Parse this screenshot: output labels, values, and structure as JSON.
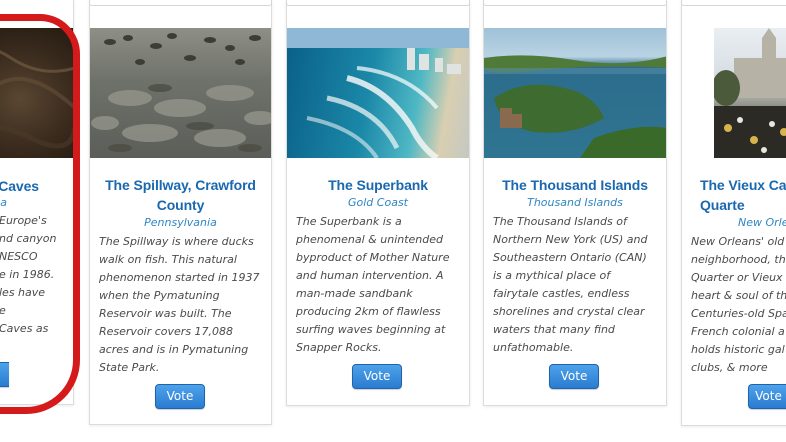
{
  "cards": [
    {
      "title": "Caves",
      "subtitle": "a",
      "description": "Europe's\nnd canyon\nNESCO\ne in 1986.\nles have\ne\nCaves as",
      "vote_label": ""
    },
    {
      "title": "The Spillway, Crawford\nCounty",
      "subtitle": "Pennsylvania",
      "description": "The Spillway is where ducks\nwalk on fish. This natural\nphenomenon started in 1937\nwhen the Pymatuning\nReservoir was built. The\nReservoir covers 17,088\nacres and is in Pymatuning\nState Park.",
      "vote_label": "Vote"
    },
    {
      "title": "The Superbank",
      "subtitle": "Gold Coast",
      "description": "The Superbank is a\nphenomenal & unintended\nbyproduct of Mother Nature\nand human intervention. A\nman-made sandbank\nproducing 2km of flawless\nsurfing waves beginning at\nSnapper Rocks.",
      "vote_label": "Vote"
    },
    {
      "title": "The Thousand Islands",
      "subtitle": "Thousand Islands",
      "description": "The Thousand Islands of\nNorthern New York (US) and\nSoutheastern Ontario (CAN)\nis a mythical place of\nfairytale castles, endless\nshorelines and crystal clear\nwaters that many find\nunfathomable.",
      "vote_label": "Vote"
    },
    {
      "title": "The Vieux Carr\nQuarte",
      "subtitle": "New Orle",
      "description": "New Orleans' old\nneighborhood, th\nQuarter or Vieux C\nheart & soul of th\nCenturies-old Spa\nFrench colonial a\nholds historic gal\nclubs, & more",
      "vote_label": "Vote"
    }
  ],
  "annotation": {
    "color": "#d41a1a"
  }
}
